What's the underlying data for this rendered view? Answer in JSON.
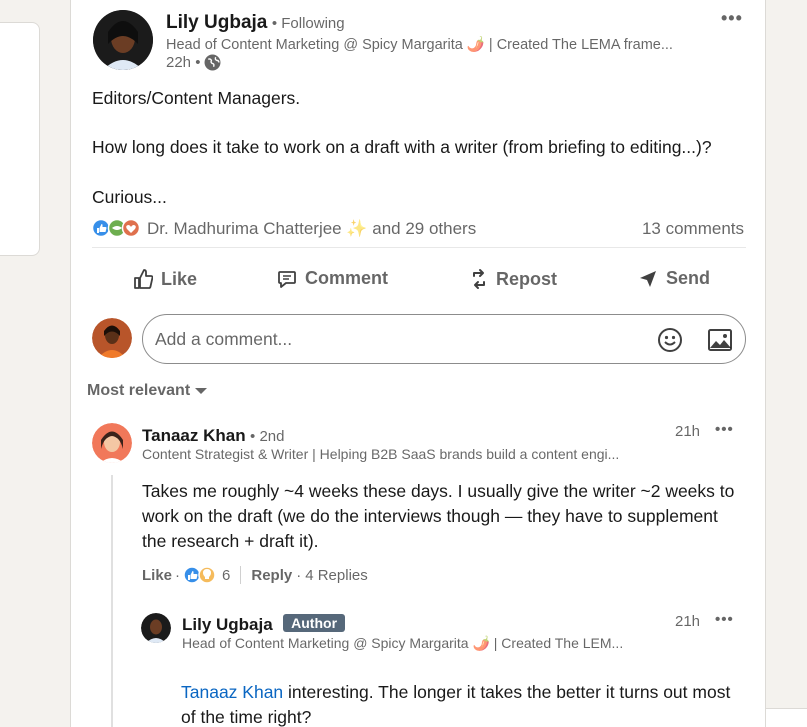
{
  "post": {
    "author": {
      "name": "Lily Ugbaja",
      "connection": "• Following",
      "headline": "Head of Content Marketing @ Spicy Margarita 🌶️ | Created The LEMA frame...",
      "time": "22h •"
    },
    "text_lines": [
      "Editors/Content Managers.",
      "How long does it take to work on a draft with a writer (from briefing to editing...)?",
      "Curious..."
    ],
    "reactions_text": "Dr. Madhurima Chatterjee ✨ and 29 others",
    "comments_count": "13 comments",
    "actions": {
      "like": "Like",
      "comment": "Comment",
      "repost": "Repost",
      "send": "Send"
    },
    "comment_input": {
      "placeholder": "Add a comment..."
    },
    "sort": "Most relevant"
  },
  "comments": [
    {
      "name": "Tanaaz Khan",
      "degree": "• 2nd",
      "headline": "Content Strategist & Writer | Helping B2B SaaS brands build a content engi...",
      "time": "21h",
      "text": "Takes me roughly ~4 weeks these days. I usually give the writer ~2 weeks to work on the draft (we do the interviews though — they have to supplement the research + draft it).",
      "like_label": "Like",
      "reaction_count": "6",
      "reply_label": "Reply",
      "replies_label": "4 Replies"
    }
  ],
  "reply": {
    "name": "Lily Ugbaja",
    "badge": "Author",
    "headline": "Head of Content Marketing @ Spicy Margarita 🌶️ | Created The LEM...",
    "time": "21h",
    "mention": "Tanaaz Khan",
    "text": " interesting. The longer it takes the better it turns out most of the time right?"
  },
  "colors": {
    "page_bg": "#f4f2ee",
    "link": "#0a66c2",
    "author_badge": "#56687a"
  }
}
